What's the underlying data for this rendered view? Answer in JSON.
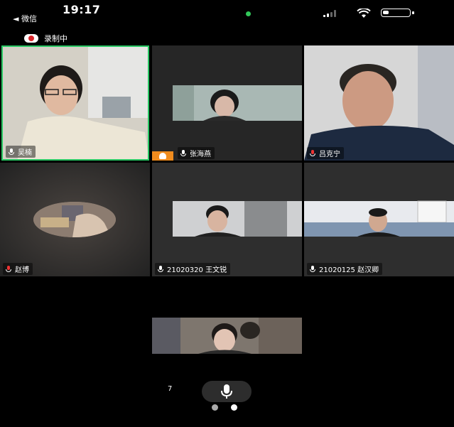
{
  "status_bar": {
    "back_label": "◄ 微信",
    "time": "19:17"
  },
  "recording": {
    "label": "录制中"
  },
  "participants": [
    {
      "name": "吴楠",
      "muted": false,
      "speaking": true
    },
    {
      "name": "张海燕",
      "muted": false,
      "host": true
    },
    {
      "name": "吕克宁",
      "muted": true
    },
    {
      "name": "赵博",
      "muted": true
    },
    {
      "name": "21020320 王文锐",
      "muted": false
    },
    {
      "name": "21020125 赵汉卿",
      "muted": false
    }
  ],
  "footer": {
    "participant_count": "7"
  },
  "colors": {
    "speaking_border": "#29c864",
    "host_badge": "#f08c1e",
    "recording_dot": "#d9252a",
    "status_green_dot": "#32c85a"
  }
}
